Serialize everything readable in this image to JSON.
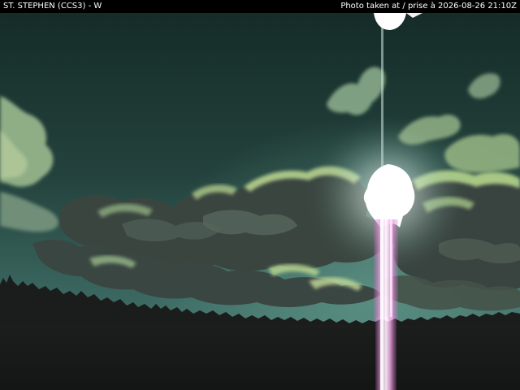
{
  "overlay": {
    "station": "ST. STEPHEN (CCS3) - W",
    "timestamp": "Photo taken at / prise à 2026-08-26 21:10Z"
  },
  "scene": {
    "type": "webcam-photo",
    "colors": {
      "sky_top": "#16302c",
      "sky_horizon": "#3c6e66",
      "cloud_highlight": "#9fc07e",
      "cloud_shadow": "#2a3532",
      "treeline": "#1a1c1b",
      "sun": "#ffffff",
      "sun_streak": "#e58ad8"
    }
  }
}
